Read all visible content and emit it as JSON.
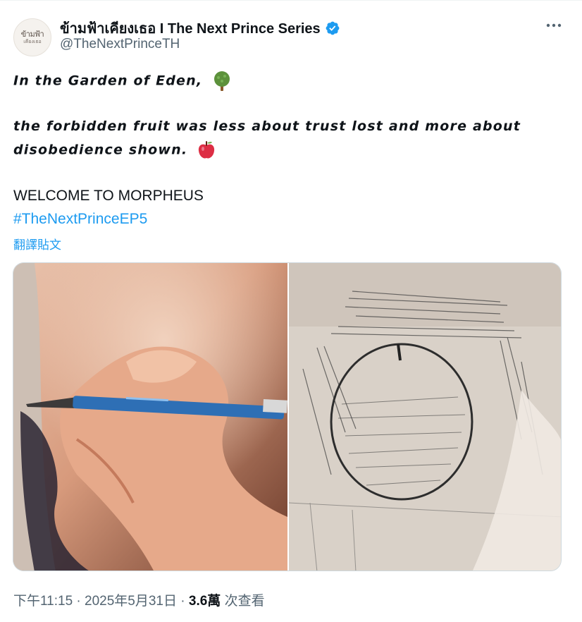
{
  "tweet": {
    "author": {
      "display_name": "ข้ามฟ้าเคียงเธอ I The Next Prince Series",
      "handle": "@TheNextPrinceTH",
      "verified": true,
      "avatar_text_line1": "ข้ามฟ้า",
      "avatar_text_line2": "เคียงเธอ"
    },
    "more_icon": "more-horizontal-icon",
    "lines": {
      "line1": "In the Garden of Eden,",
      "line2": "the forbidden fruit was less about trust lost and more about",
      "line3": "disobedience shown.",
      "line4": "WELCOME TO MORPHEUS"
    },
    "hashtag": "#TheNextPrinceEP5",
    "translate_label": "翻譯貼文",
    "emojis": [
      "tree-emoji",
      "red-apple-emoji"
    ],
    "media": [
      {
        "name": "hand-sketching-photo"
      },
      {
        "name": "apple-pencil-sketch-photo"
      }
    ],
    "meta": {
      "time": "下午11:15",
      "separator": "·",
      "date": "2025年5月31日",
      "views_count": "3.6萬",
      "views_label": "次查看"
    },
    "colors": {
      "link": "#1d9bf0",
      "text": "#0f1419",
      "secondary": "#536471"
    }
  }
}
